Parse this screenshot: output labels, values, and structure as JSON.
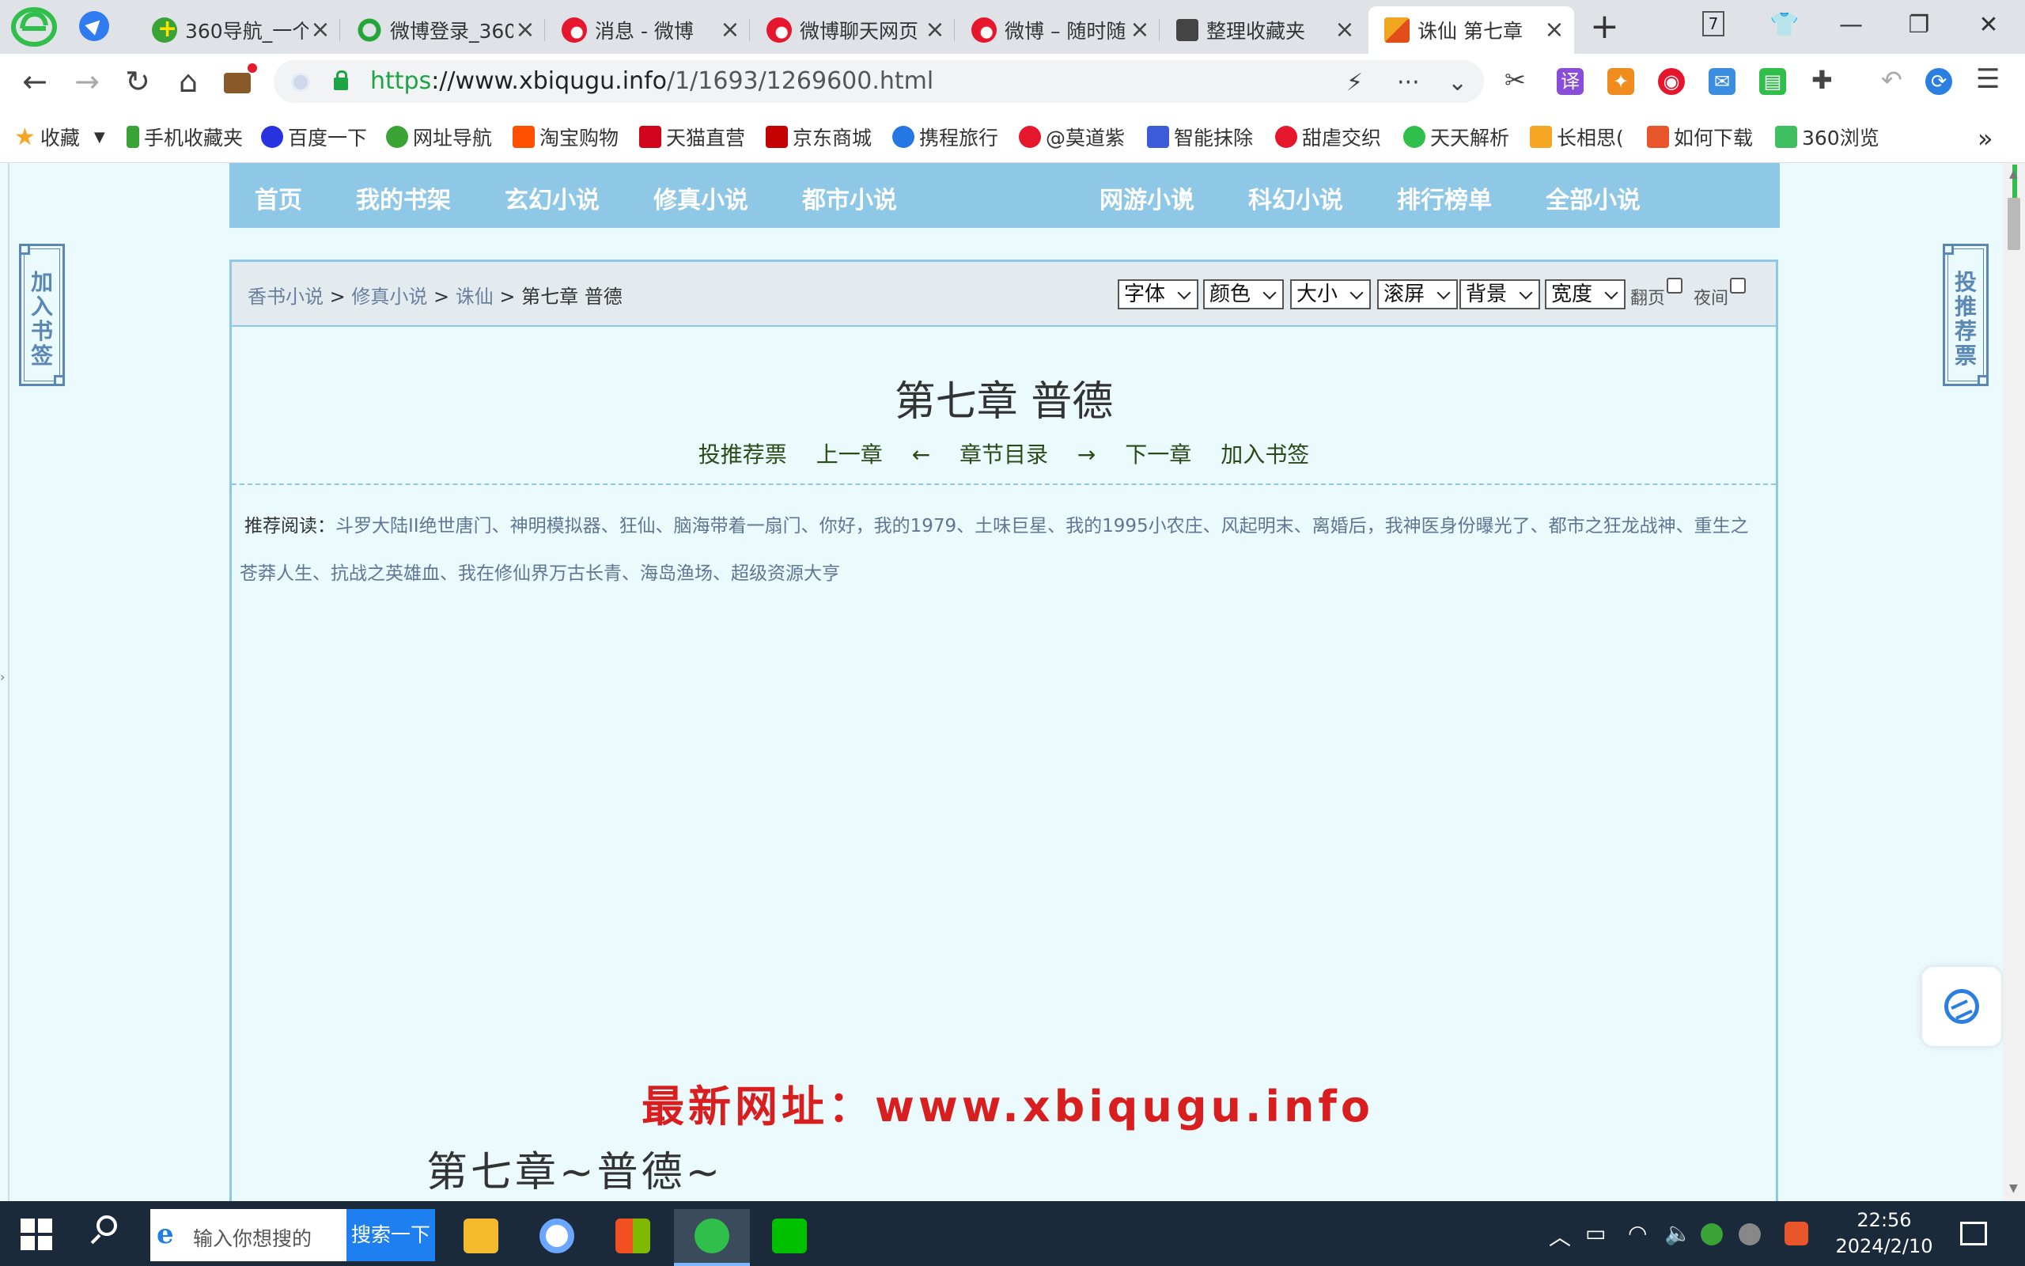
{
  "browser": {
    "tabs": [
      {
        "title": "360导航_一个",
        "icon": "360-nav-icon",
        "active": false
      },
      {
        "title": "微博登录_360",
        "icon": "360-search-icon",
        "active": false
      },
      {
        "title": "消息 - 微博",
        "icon": "weibo-icon",
        "active": false
      },
      {
        "title": "微博聊天网页",
        "icon": "weibo-icon",
        "active": false
      },
      {
        "title": "微博 – 随时随",
        "icon": "weibo-icon",
        "active": false
      },
      {
        "title": "整理收藏夹",
        "icon": "bookmark-manager-icon",
        "active": false
      },
      {
        "title": "诛仙 第七章",
        "icon": "site-house-icon",
        "active": true
      }
    ],
    "tab_count": "7",
    "url": {
      "scheme": "https",
      "separator": "://",
      "host": "www.xbiqugu.info",
      "path": "/1/1693/1269600.html"
    },
    "bookmarks_bar": [
      {
        "label": "收藏",
        "icon": "star-icon",
        "color": "#f5a623"
      },
      {
        "label": "手机收藏夹",
        "icon": "phone-icon",
        "color": "#3aa336"
      },
      {
        "label": "百度一下",
        "icon": "baidu-paw-icon",
        "color": "#2932e1"
      },
      {
        "label": "网址导航",
        "icon": "360-nav-icon",
        "color": "#3aa336"
      },
      {
        "label": "淘宝购物",
        "icon": "taobao-icon",
        "color": "#ff5000"
      },
      {
        "label": "天猫直营",
        "icon": "tmall-icon",
        "color": "#d2041b"
      },
      {
        "label": "京东商城",
        "icon": "jd-icon",
        "color": "#c40000"
      },
      {
        "label": "携程旅行",
        "icon": "ctrip-icon",
        "color": "#2577e3"
      },
      {
        "label": "@莫道紫",
        "icon": "weibo-icon",
        "color": "#e6162d"
      },
      {
        "label": "智能抹除",
        "icon": "z-icon",
        "color": "#3b5bdb"
      },
      {
        "label": "甜虐交织",
        "icon": "weibo-icon",
        "color": "#e6162d"
      },
      {
        "label": "天天解析",
        "icon": "download-icon",
        "color": "#2fbf4a"
      },
      {
        "label": "长相思(",
        "icon": "feather-icon",
        "color": "#f5a623"
      },
      {
        "label": "如何下载",
        "icon": "c-icon",
        "color": "#e8552b"
      },
      {
        "label": "360浏览",
        "icon": "number-8-icon",
        "color": "#3fbf5f"
      }
    ]
  },
  "site": {
    "nav": [
      "首页",
      "我的书架",
      "玄幻小说",
      "修真小说",
      "都市小说",
      "网游小说",
      "科幻小说",
      "排行榜单",
      "全部小说"
    ],
    "breadcrumb": [
      "香书小说",
      "修真小说",
      "诛仙",
      "第七章 普德"
    ],
    "breadcrumb_sep": ">",
    "reader_controls": {
      "font": "字体",
      "color": "颜色",
      "size": "大小",
      "scroll": "滚屏",
      "background": "背景",
      "width": "宽度",
      "page_flip": "翻页",
      "night": "夜间"
    },
    "chapter_title": "第七章 普德",
    "chapter_links": {
      "vote": "投推荐票",
      "prev": "上一章",
      "arrow_left": "←",
      "toc": "章节目录",
      "arrow_right": "→",
      "next": "下一章",
      "bookmark": "加入书签"
    },
    "recommend": {
      "label": "推荐阅读：",
      "books": "斗罗大陆II绝世唐门、神明模拟器、狂仙、脑海带着一扇门、你好，我的1979、土味巨星、我的1995小农庄、风起明末、离婚后，我神医身份曝光了、都市之狂龙战神、重生之苍莽人生、抗战之英雄血、我在修仙界万古长青、海岛渔场、超级资源大亨"
    },
    "promo": "最新网址：www.xbiqugu.info",
    "body_first_line": "第七章~普德~",
    "side_left": "加入书签",
    "side_right": "投推荐票"
  },
  "taskbar": {
    "search_placeholder": "输入你想搜的",
    "search_button": "搜索一下",
    "time": "22:56",
    "date": "2024/2/10"
  },
  "colors": {
    "nav_bar": "#8ec8e6",
    "page_bg": "#eafafd",
    "promo_red": "#d81e1e",
    "link_green": "#2c4a18"
  }
}
